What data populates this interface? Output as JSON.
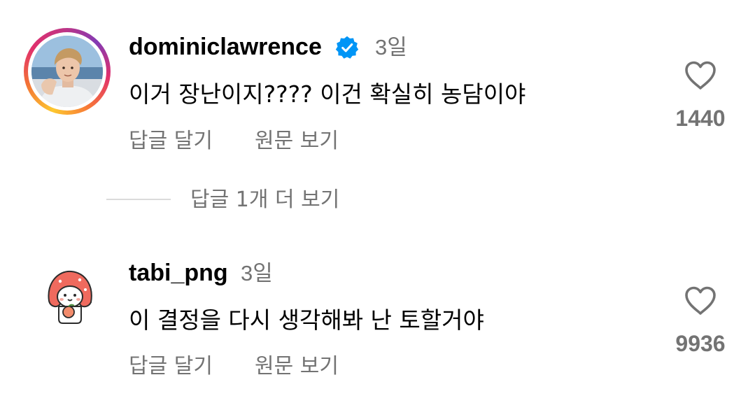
{
  "comments": [
    {
      "username": "dominiclawrence",
      "verified": true,
      "time": "3일",
      "text": "이거 장난이지???? 이건 확실히 농담이야",
      "reply_label": "답글 달기",
      "translate_label": "원문 보기",
      "likes": "1440"
    },
    {
      "username": "tabi_png",
      "verified": false,
      "time": "3일",
      "text": "이 결정을 다시 생각해봐 난 토할거야",
      "reply_label": "답글 달기",
      "translate_label": "원문 보기",
      "likes": "9936"
    }
  ],
  "view_replies_label": "답글 1개 더 보기",
  "colors": {
    "text_primary": "#000000",
    "text_secondary": "#737373",
    "verified_badge": "#0095f6",
    "divider": "#dbdbdb"
  },
  "icons": {
    "like": "heart-outline-icon",
    "verified": "verified-badge-icon"
  }
}
